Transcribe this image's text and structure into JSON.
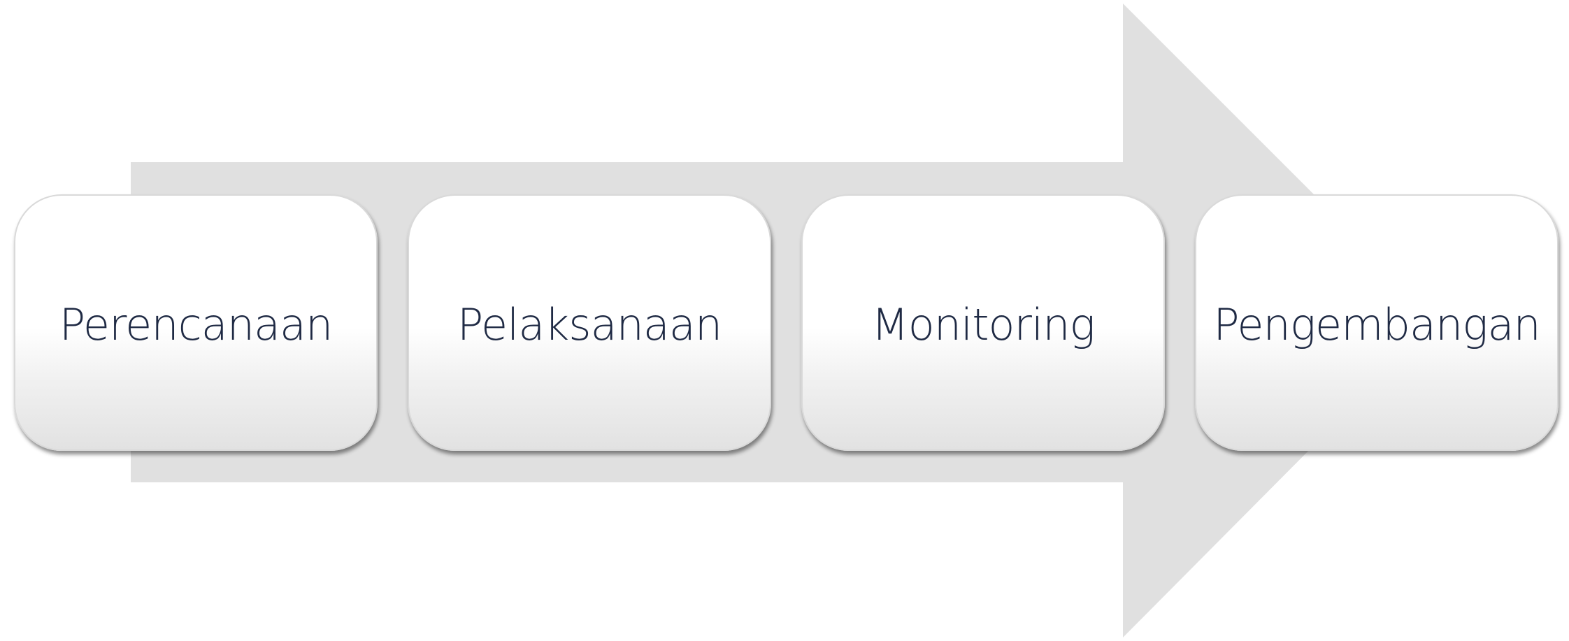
{
  "diagram": {
    "type": "process-arrow",
    "arrow_color": "#e0e0e0",
    "text_color": "#1f2a44",
    "steps": [
      {
        "label": "Perencanaan"
      },
      {
        "label": "Pelaksanaan"
      },
      {
        "label": "Monitoring"
      },
      {
        "label": "Pengembangan"
      }
    ]
  }
}
